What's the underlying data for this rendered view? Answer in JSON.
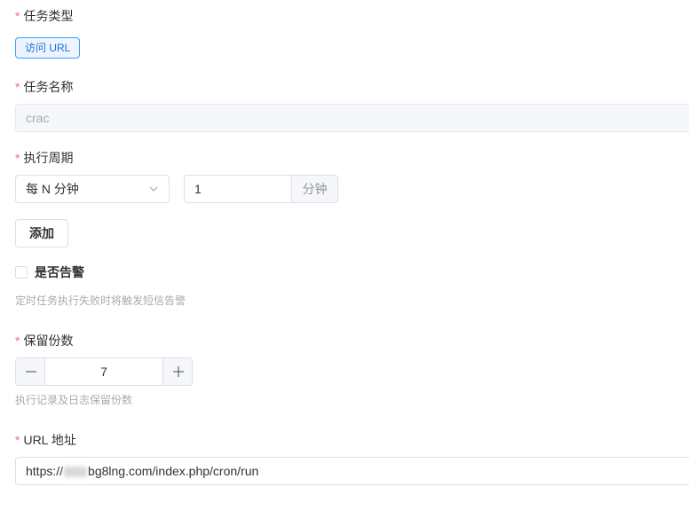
{
  "task_type": {
    "label": "任务类型",
    "tag": "访问 URL"
  },
  "task_name": {
    "label": "任务名称",
    "value": "crac"
  },
  "period": {
    "label": "执行周期",
    "select_value": "每 N 分钟",
    "number_value": "1",
    "unit": "分钟",
    "add_label": "添加"
  },
  "alert": {
    "checkbox_label": "是否告警",
    "checked": false,
    "help": "定时任务执行失败时将触发短信告警"
  },
  "retain": {
    "label": "保留份数",
    "value": "7",
    "help": "执行记录及日志保留份数"
  },
  "url": {
    "label": "URL 地址",
    "value_prefix": "https://",
    "value_suffix": "bg8lng.com/index.php/cron/run"
  },
  "required_mark": "*",
  "colors": {
    "required": "#f56c6c",
    "accent": "#409eff"
  }
}
